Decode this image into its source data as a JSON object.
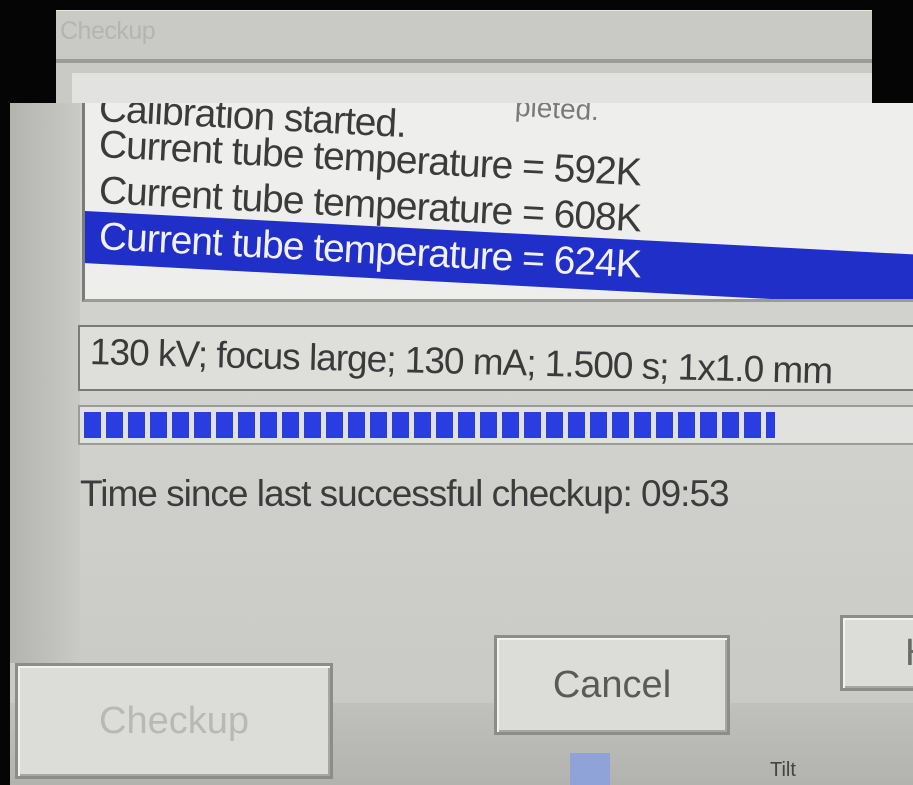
{
  "back_window": {
    "title": "Checkup"
  },
  "log": {
    "trailing_text": "pleted.",
    "items": [
      "Calibration started.",
      "Current tube temperature = 592K",
      "Current tube temperature = 608K",
      "Current tube temperature = 624K"
    ],
    "selected_index": 3
  },
  "parameters": {
    "text": "130 kV; focus large; 130 mA; 1.500 s; 1x1.0 mm"
  },
  "progress": {
    "fraction": 0.83
  },
  "status": {
    "time_since_label": "Time since last successful checkup: 09:53"
  },
  "buttons": {
    "checkup": "Checkup",
    "cancel": "Cancel",
    "help": "H"
  },
  "bottom": {
    "tilt_label": "Tilt"
  },
  "colors": {
    "selection": "#1f2fc7",
    "progress": "#2a3de0"
  }
}
